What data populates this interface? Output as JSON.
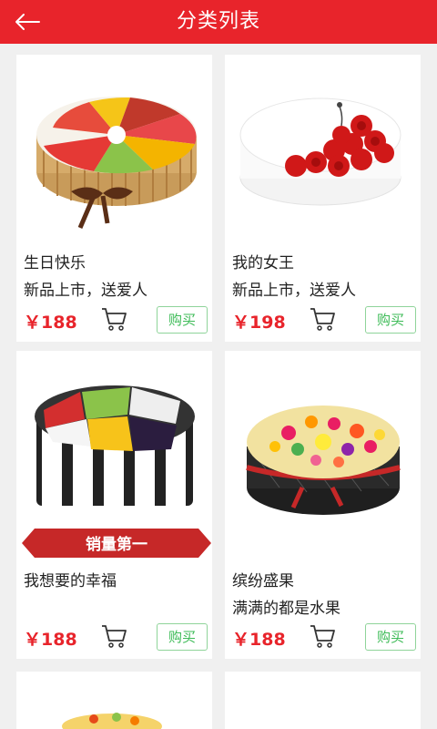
{
  "header": {
    "title": "分类列表"
  },
  "products": [
    {
      "name": "生日快乐",
      "desc": "新品上市，送爱人",
      "price": "￥188",
      "buy_label": "购买"
    },
    {
      "name": "我的女王",
      "desc": "新品上市，送爱人",
      "price": "￥198",
      "buy_label": "购买"
    },
    {
      "name": "我想要的幸福",
      "desc": "",
      "price": "￥188",
      "buy_label": "购买",
      "banner": "销量第一"
    },
    {
      "name": "缤纷盛果",
      "desc": "满满的都是水果",
      "price": "￥188",
      "buy_label": "购买"
    }
  ],
  "colors": {
    "primary": "#e8242b",
    "buy_green": "#3dbb57",
    "background": "#f0f0f0"
  },
  "icons": {
    "back": "arrow-left-icon",
    "cart": "shopping-cart-icon"
  }
}
